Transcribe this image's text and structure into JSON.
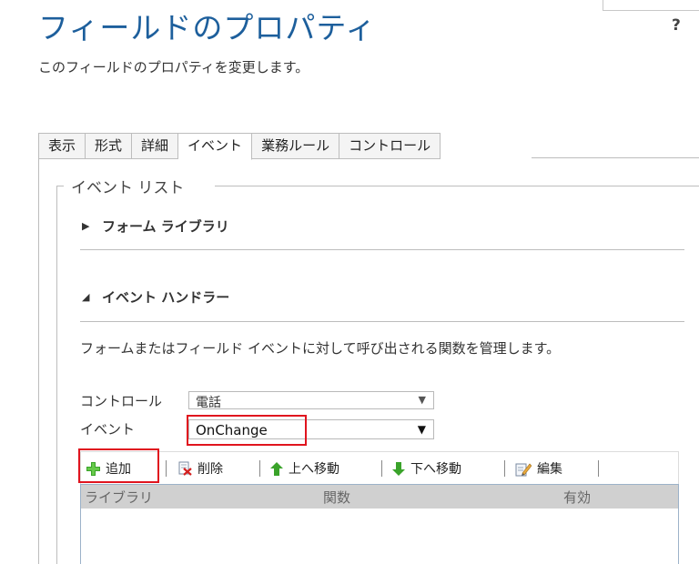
{
  "header": {
    "title": "フィールドのプロパティ",
    "subtitle": "このフィールドのプロパティを変更します。",
    "help_label": "?"
  },
  "tabs": [
    {
      "label": "表示",
      "active": false
    },
    {
      "label": "形式",
      "active": false
    },
    {
      "label": "詳細",
      "active": false
    },
    {
      "label": "イベント",
      "active": true
    },
    {
      "label": "業務ルール",
      "active": false
    },
    {
      "label": "コントロール",
      "active": false
    }
  ],
  "event_list": {
    "legend": "イベント リスト",
    "form_library": {
      "label": "フォーム ライブラリ",
      "expanded": false
    },
    "event_handlers": {
      "label": "イベント ハンドラー",
      "expanded": true,
      "description": "フォームまたはフィールド イベントに対して呼び出される関数を管理します。",
      "control_label": "コントロール",
      "control_value": "電話",
      "event_label": "イベント",
      "event_value": "OnChange"
    }
  },
  "toolbar": {
    "add_label": "追加",
    "delete_label": "削除",
    "move_up_label": "上へ移動",
    "move_down_label": "下へ移動",
    "edit_label": "編集"
  },
  "grid": {
    "columns": [
      "ライブラリ",
      "関数",
      "有効"
    ],
    "rows": []
  },
  "colors": {
    "title": "#1d5f9c",
    "highlight": "#e0141e",
    "grid_header": "#d0d0d0"
  },
  "icons": {
    "add": "plus-icon",
    "delete": "delete-icon",
    "move_up": "arrow-up-icon",
    "move_down": "arrow-down-icon",
    "edit": "edit-icon"
  }
}
